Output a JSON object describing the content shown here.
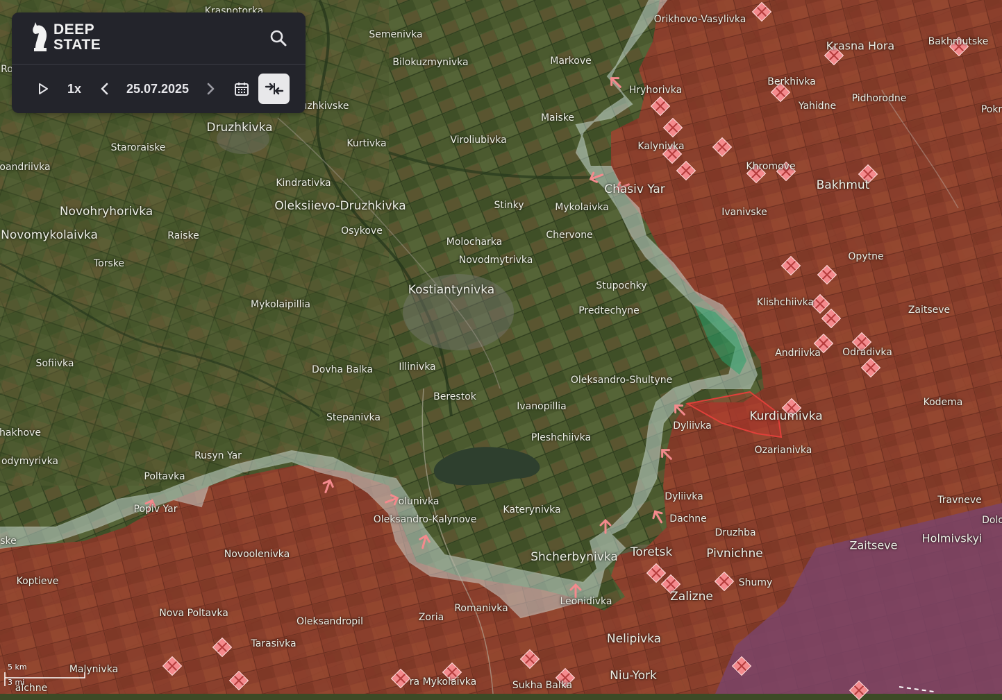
{
  "app": {
    "logo_line1": "DEEP",
    "logo_line2": "STATE"
  },
  "toolbar": {
    "speed_label": "1x",
    "date": "25.07.2025",
    "icons": {
      "play": "play-icon",
      "prev": "chevron-left-icon",
      "next": "chevron-right-icon",
      "calendar": "calendar-icon",
      "compare": "compare-arrows-icon",
      "search": "search-icon"
    }
  },
  "scale": {
    "km_label": "5 km",
    "mi_label": "3 mi"
  },
  "colors": {
    "occupied": "#8f3a2a",
    "contested": "#cfe3e0",
    "liberated": "#2aa36b",
    "advance_area": "#d8322e",
    "crimea_zone": "#8a4f7a",
    "marker": "#f48a8d",
    "panel_bg": "#23242b"
  },
  "places": [
    {
      "id": "krasnotorka",
      "name": "Krasnotorka",
      "size": "s"
    },
    {
      "id": "semenivka",
      "name": "Semenivka",
      "size": "s"
    },
    {
      "id": "orikhovo-vasylivka",
      "name": "Orikhovo-Vasylivka",
      "size": "s"
    },
    {
      "id": "krasna-hora",
      "name": "Krasna Hora",
      "size": "m"
    },
    {
      "id": "bakhmutske",
      "name": "Bakhmutske",
      "size": "s"
    },
    {
      "id": "bilokuzmynivka",
      "name": "Bilokuzmynivka",
      "size": "s"
    },
    {
      "id": "markove",
      "name": "Markove",
      "size": "s"
    },
    {
      "id": "berkhivka",
      "name": "Berkhivka",
      "size": "s"
    },
    {
      "id": "hryhorivka",
      "name": "Hryhorivka",
      "size": "s"
    },
    {
      "id": "yahidne",
      "name": "Yahidne",
      "size": "s"
    },
    {
      "id": "pidhorodne",
      "name": "Pidhorodne",
      "size": "s"
    },
    {
      "id": "pokr",
      "name": "Pokr",
      "size": "s"
    },
    {
      "id": "kuzhkivske",
      "name": "uzhkivske",
      "size": "s"
    },
    {
      "id": "druzhkivka",
      "name": "Druzhkivka",
      "size": "l"
    },
    {
      "id": "maiske",
      "name": "Maiske",
      "size": "s"
    },
    {
      "id": "staroraiske",
      "name": "Staroraiske",
      "size": "s"
    },
    {
      "id": "kurtivka",
      "name": "Kurtivka",
      "size": "s"
    },
    {
      "id": "virolubivka",
      "name": "Viroliubivka",
      "size": "s"
    },
    {
      "id": "kalynivka",
      "name": "Kalynivka",
      "size": "s"
    },
    {
      "id": "oleksandrivka-w",
      "name": "oandriivka",
      "size": "s"
    },
    {
      "id": "khromove",
      "name": "Khromove",
      "size": "s"
    },
    {
      "id": "bakhmut",
      "name": "Bakhmut",
      "size": "l"
    },
    {
      "id": "kindrativka",
      "name": "Kindrativka",
      "size": "s"
    },
    {
      "id": "chasiv-yar",
      "name": "Chasiv Yar",
      "size": "l"
    },
    {
      "id": "novohryhorivka",
      "name": "Novohryhorivka",
      "size": "l"
    },
    {
      "id": "oleksiievo-druzhkivka",
      "name": "Oleksiievo-Druzhkivka",
      "size": "l"
    },
    {
      "id": "stinky",
      "name": "Stinky",
      "size": "s"
    },
    {
      "id": "mykolaivka",
      "name": "Mykolaivka",
      "size": "s"
    },
    {
      "id": "ivanivske",
      "name": "Ivanivske",
      "size": "s"
    },
    {
      "id": "osykove",
      "name": "Osykove",
      "size": "s"
    },
    {
      "id": "novomykolaivka",
      "name": "Novomykolaivka",
      "size": "l"
    },
    {
      "id": "raiske",
      "name": "Raiske",
      "size": "s"
    },
    {
      "id": "chervone",
      "name": "Chervone",
      "size": "s"
    },
    {
      "id": "molocharka",
      "name": "Molocharka",
      "size": "s"
    },
    {
      "id": "novodmytrivka",
      "name": "Novodmytrivka",
      "size": "s"
    },
    {
      "id": "opytne",
      "name": "Opytne",
      "size": "s"
    },
    {
      "id": "torske",
      "name": "Torske",
      "size": "s"
    },
    {
      "id": "stupochky",
      "name": "Stupochky",
      "size": "s"
    },
    {
      "id": "kostiantynivka",
      "name": "Kostiantynivka",
      "size": "l"
    },
    {
      "id": "mykolaipillia",
      "name": "Mykolaipillia",
      "size": "s"
    },
    {
      "id": "klishchiivka",
      "name": "Klishchiivka",
      "size": "s"
    },
    {
      "id": "predtechyne",
      "name": "Predtechyne",
      "size": "s"
    },
    {
      "id": "zaitseve-n",
      "name": "Zaitseve",
      "size": "s"
    },
    {
      "id": "andriivka",
      "name": "Andriivka",
      "size": "s"
    },
    {
      "id": "odradivka",
      "name": "Odradivka",
      "size": "s"
    },
    {
      "id": "sofiivka",
      "name": "Sofiivka",
      "size": "s"
    },
    {
      "id": "illinivka",
      "name": "Illinivka",
      "size": "s"
    },
    {
      "id": "dovha-balka",
      "name": "Dovha Balka",
      "size": "s"
    },
    {
      "id": "oleksandro-shultyne",
      "name": "Oleksandro-Shultyne",
      "size": "s"
    },
    {
      "id": "berestok",
      "name": "Berestok",
      "size": "s"
    },
    {
      "id": "ivanopillia",
      "name": "Ivanopillia",
      "size": "s"
    },
    {
      "id": "kodema",
      "name": "Kodema",
      "size": "s"
    },
    {
      "id": "kurdiumivka",
      "name": "Kurdiumivka",
      "size": "l"
    },
    {
      "id": "dyliivka-n",
      "name": "Dyliivka",
      "size": "s"
    },
    {
      "id": "stepanivka",
      "name": "Stepanivka",
      "size": "s"
    },
    {
      "id": "shakhove",
      "name": "hakhove",
      "size": "s"
    },
    {
      "id": "pleshchiivka",
      "name": "Pleshchiivka",
      "size": "s"
    },
    {
      "id": "ozarianivka",
      "name": "Ozarianivka",
      "size": "s"
    },
    {
      "id": "rusyn-yar",
      "name": "Rusyn Yar",
      "size": "s"
    },
    {
      "id": "volodymyrivka",
      "name": "odymyrivka",
      "size": "s"
    },
    {
      "id": "poltavka",
      "name": "Poltavka",
      "size": "s"
    },
    {
      "id": "dyliivka-s",
      "name": "Dyliivka",
      "size": "s"
    },
    {
      "id": "travneve",
      "name": "Travneve",
      "size": "s"
    },
    {
      "id": "polunivka",
      "name": "olunivka",
      "size": "s"
    },
    {
      "id": "popiv-yar",
      "name": "Popiv Yar",
      "size": "s"
    },
    {
      "id": "katerynivka",
      "name": "Katerynivka",
      "size": "s"
    },
    {
      "id": "dachne",
      "name": "Dachne",
      "size": "s"
    },
    {
      "id": "dolomitne",
      "name": "Dolo",
      "size": "s"
    },
    {
      "id": "oleksandro-kalynove",
      "name": "Oleksandro-Kalynove",
      "size": "s"
    },
    {
      "id": "druzhba",
      "name": "Druzhba",
      "size": "s"
    },
    {
      "id": "holmivskyi",
      "name": "Holmivskyi",
      "size": "m"
    },
    {
      "id": "iske",
      "name": "ske",
      "size": "s"
    },
    {
      "id": "zaitseve-s",
      "name": "Zaitseve",
      "size": "m"
    },
    {
      "id": "toretsk",
      "name": "Toretsk",
      "size": "l"
    },
    {
      "id": "pivnichne",
      "name": "Pivnichne",
      "size": "l"
    },
    {
      "id": "novoolenivka",
      "name": "Novoolenivka",
      "size": "s"
    },
    {
      "id": "shcherbynivka",
      "name": "Shcherbynivka",
      "size": "l"
    },
    {
      "id": "koptieve",
      "name": "Koptieve",
      "size": "s"
    },
    {
      "id": "shumy",
      "name": "Shumy",
      "size": "s"
    },
    {
      "id": "zalizne",
      "name": "Zalizne",
      "size": "l"
    },
    {
      "id": "leonidivka",
      "name": "Leonidivka",
      "size": "s"
    },
    {
      "id": "nova-poltavka",
      "name": "Nova Poltavka",
      "size": "s"
    },
    {
      "id": "romanivka",
      "name": "Romanivka",
      "size": "s"
    },
    {
      "id": "zoria",
      "name": "Zoria",
      "size": "s"
    },
    {
      "id": "oleksandropil",
      "name": "Oleksandropil",
      "size": "s"
    },
    {
      "id": "nelipivka",
      "name": "Nelipivka",
      "size": "l"
    },
    {
      "id": "tarasivka",
      "name": "Tarasivka",
      "size": "s"
    },
    {
      "id": "malynivka",
      "name": "Malynivka",
      "size": "s"
    },
    {
      "id": "niu-york",
      "name": "Niu-York",
      "size": "l"
    },
    {
      "id": "stara-mykolaivka",
      "name": "ra Mykolaivka",
      "size": "s"
    },
    {
      "id": "sukha-balka",
      "name": "Sukha Balka",
      "size": "s"
    },
    {
      "id": "malchne",
      "name": "alchne",
      "size": "s"
    },
    {
      "id": "ro",
      "name": "Ro",
      "size": "s"
    }
  ]
}
